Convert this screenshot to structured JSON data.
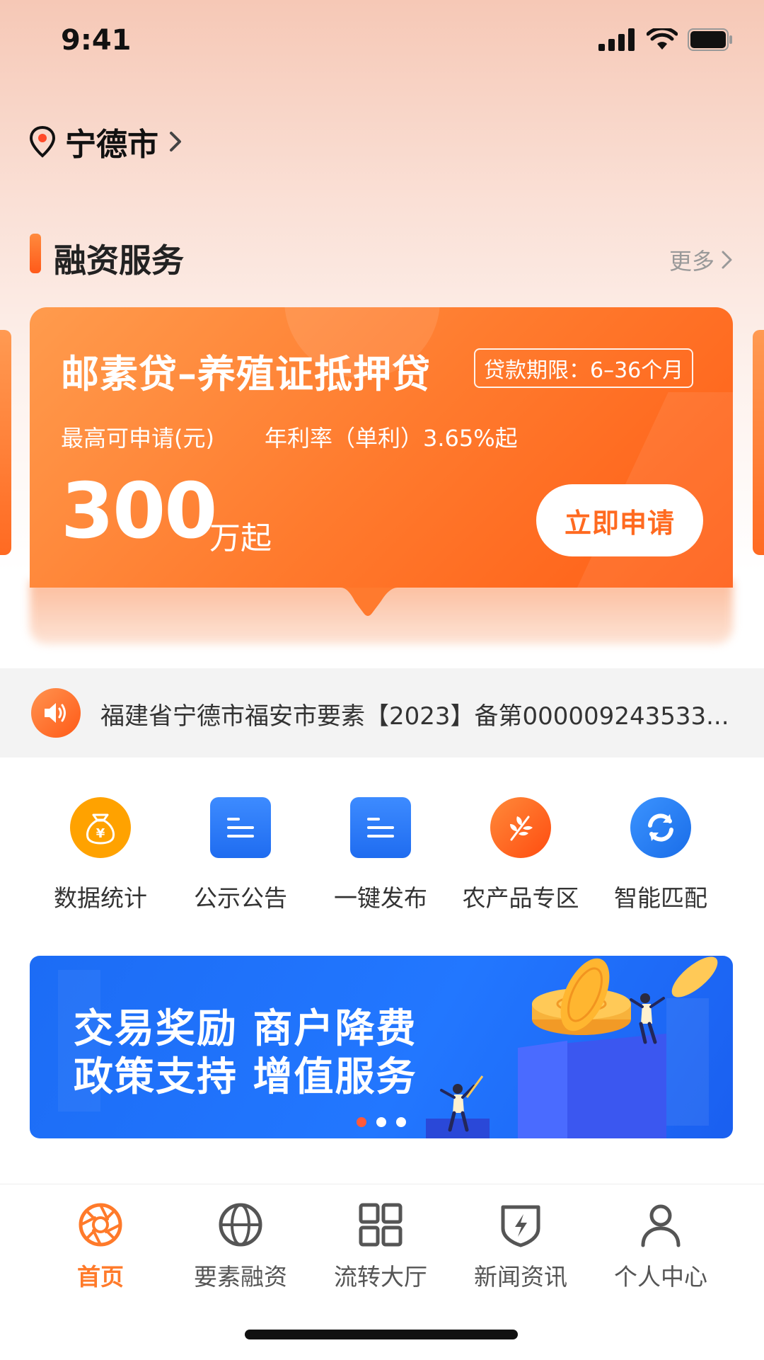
{
  "status_bar": {
    "time": "9:41"
  },
  "location": {
    "city": "宁德市"
  },
  "financing": {
    "section_title": "融资服务",
    "more_label": "更多",
    "card": {
      "product_name": "邮素贷–养殖证抵押贷",
      "term_badge": "贷款期限：6–36个月",
      "max_label": "最高可申请(元)",
      "rate_label": "年利率（单利）3.65%起",
      "amount": "300",
      "amount_unit": "万起",
      "apply_label": "立即申请"
    }
  },
  "notice": {
    "text": "福建省宁德市福安市要素【2023】备第000009243533..."
  },
  "quick_actions": [
    {
      "label": "数据统计",
      "icon": "money-bag-icon",
      "color": "#ff9a00"
    },
    {
      "label": "公示公告",
      "icon": "document-icon",
      "color": "#2e7cf6"
    },
    {
      "label": "一键发布",
      "icon": "document-icon",
      "color": "#2e7cf6"
    },
    {
      "label": "农产品专区",
      "icon": "leaf-icon",
      "color": "#ff5a17"
    },
    {
      "label": "智能匹配",
      "icon": "refresh-icon",
      "color": "#1e7df0"
    }
  ],
  "banner": {
    "line1": "交易奖励 商户降费",
    "line2": "政策支持 增值服务",
    "slide_count": 3,
    "active_slide": 1
  },
  "tab_bar": {
    "active_color": "#ff7a2a",
    "tabs": [
      {
        "label": "首页",
        "icon": "aperture-icon",
        "active": true
      },
      {
        "label": "要素融资",
        "icon": "globe-icon",
        "active": false
      },
      {
        "label": "流转大厅",
        "icon": "grid-icon",
        "active": false
      },
      {
        "label": "新闻资讯",
        "icon": "shield-bolt-icon",
        "active": false
      },
      {
        "label": "个人中心",
        "icon": "person-icon",
        "active": false
      }
    ]
  }
}
